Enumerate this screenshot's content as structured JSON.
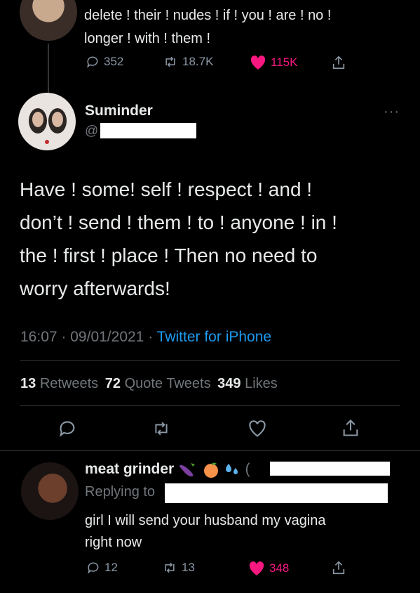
{
  "top_tweet": {
    "text_line1": "delete ! their ! nudes ! if ! you ! are ! no !",
    "text_line2": "longer ! with ! them !",
    "replies": "352",
    "retweets": "18.7K",
    "likes": "115K"
  },
  "main_tweet": {
    "name": "Suminder",
    "handle_prefix": "@",
    "more": "···",
    "lines": [
      "Have ! some! self ! respect ! and !",
      "don’t ! send ! them ! to ! anyone ! in !",
      "the ! first ! place ! Then no need to",
      "worry afterwards!"
    ],
    "time": "16:07",
    "sep": "·",
    "date": "09/01/2021",
    "sep2": "·",
    "source": "Twitter for iPhone",
    "retweet_count": "13",
    "retweet_label": "Retweets",
    "quote_count": "72",
    "quote_label": "Quote Tweets",
    "like_count": "349",
    "like_label": "Likes"
  },
  "reply_tweet": {
    "name": "meat grinder",
    "replying_to": "Replying to",
    "text_line1": "girl I will send your husband my vagina",
    "text_line2": "right now",
    "replies": "12",
    "retweets": "13",
    "likes": "348"
  },
  "colors": {
    "like_red": "#f91880",
    "link_blue": "#1d9bf0"
  }
}
